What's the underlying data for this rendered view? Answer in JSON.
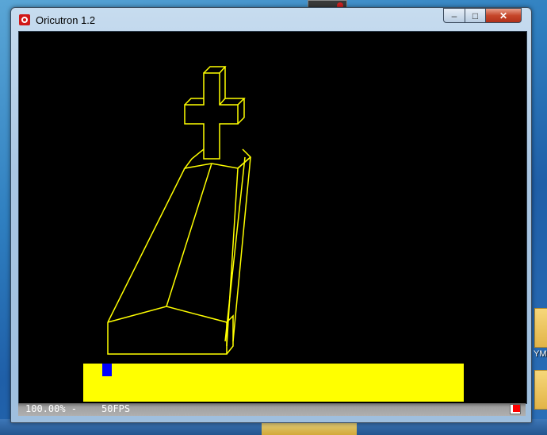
{
  "window": {
    "title": "Oricutron 1.2",
    "controls": {
      "minimize": "–",
      "maximize": "□",
      "close": "✕"
    }
  },
  "desktop": {
    "side_label": "YM"
  },
  "screen": {
    "background": "#000000",
    "line_color": "#ffff00",
    "drawing": "wireframe tombstone with cross",
    "text_bar_color": "#ffff00",
    "cursor_color": "#0000ff"
  },
  "status": {
    "zoom": "100.00% -",
    "fps": "50FPS",
    "indicator_color": "#ff0000"
  }
}
